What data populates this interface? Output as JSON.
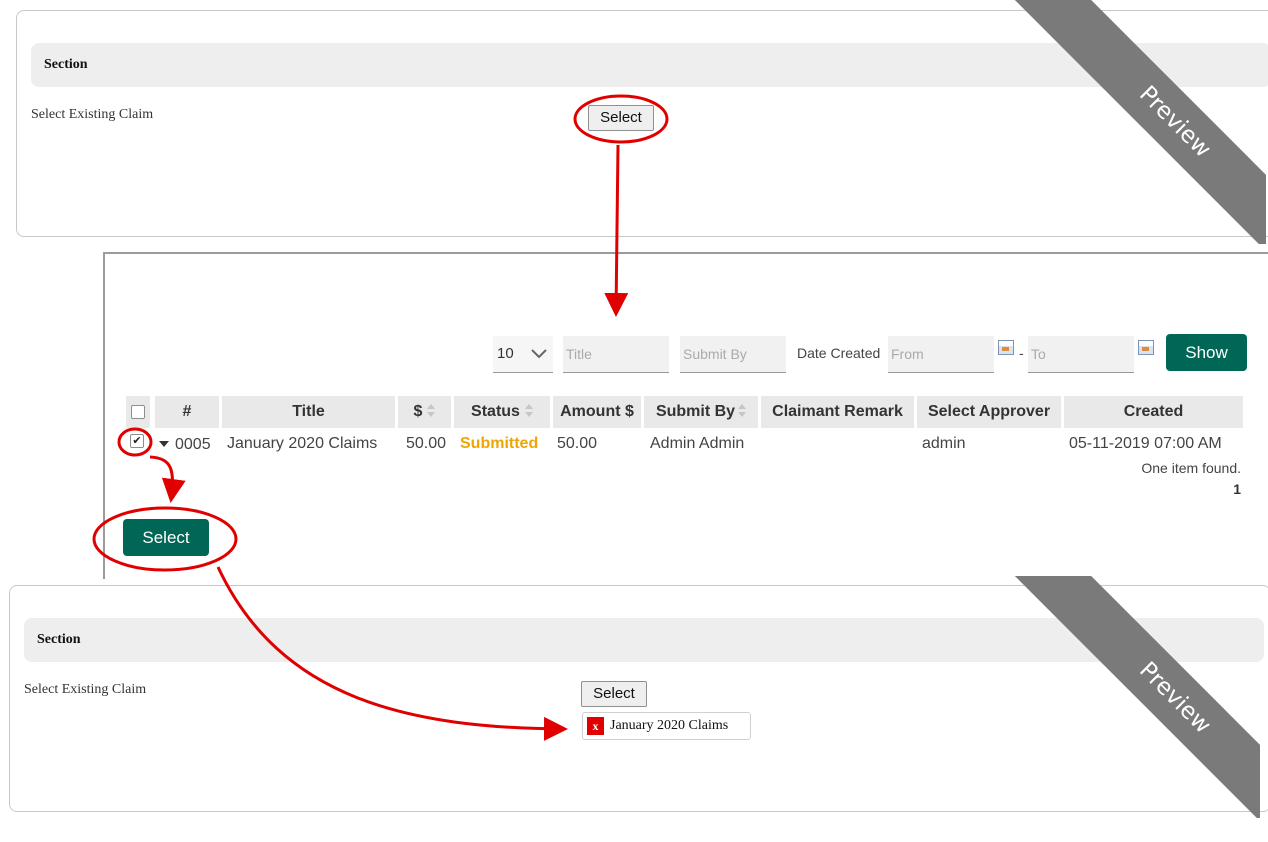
{
  "section": {
    "title": "Section",
    "label": "Select Existing Claim",
    "select_button": "Select",
    "ribbon": "Preview"
  },
  "list": {
    "page_size": "10",
    "filters": {
      "title_placeholder": "Title",
      "submit_by_placeholder": "Submit By",
      "date_created_label": "Date Created",
      "from_placeholder": "From",
      "separator": "-",
      "to_placeholder": "To"
    },
    "show_button": "Show",
    "columns": [
      "#",
      "Title",
      "$",
      "Status",
      "Amount $",
      "Submit By",
      "Claimant Remark",
      "Select Approver",
      "Created"
    ],
    "row": {
      "checked": true,
      "number": "0005",
      "title": "January 2020 Claims",
      "dollar": "50.00",
      "status": "Submitted",
      "status_color": "#f0a500",
      "amount": "50.00",
      "submit_by": "Admin Admin",
      "claimant_remark": "",
      "approver": "admin",
      "created": "05-11-2019 07:00 AM"
    },
    "summary": "One item found.",
    "page": "1",
    "select_button": "Select"
  },
  "result": {
    "selected_tag": "January 2020 Claims",
    "remove_glyph": "x"
  },
  "colors": {
    "accent": "#006655",
    "annotation": "#e00000",
    "ribbon": "#7a7a7a"
  }
}
